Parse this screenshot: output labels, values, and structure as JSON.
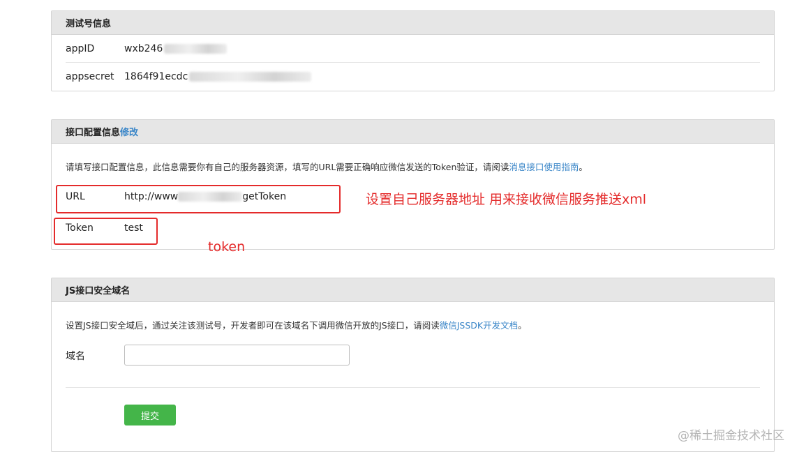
{
  "test_account": {
    "title": "测试号信息",
    "appid_label": "appID",
    "appid_value": "wxb246",
    "appsecret_label": "appsecret",
    "appsecret_value": "1864f91ecdc"
  },
  "interface_config": {
    "title": "接口配置信息",
    "edit_link": "修改",
    "description": "请填写接口配置信息，此信息需要你有自己的服务器资源，填写的URL需要正确响应微信发送的Token验证，请阅读",
    "guide_link": "消息接口使用指南",
    "description_end": "。",
    "url_label": "URL",
    "url_value_start": "http://www",
    "url_value_end": "getToken",
    "token_label": "Token",
    "token_value": "test"
  },
  "annotations": {
    "url_note": "设置自己服务器地址 用来接收微信服务推送xml",
    "token_note": "token"
  },
  "js_domain": {
    "title": "JS接口安全域名",
    "description": "设置JS接口安全域后，通过关注该测试号，开发者即可在该域名下调用微信开放的JS接口，请阅读",
    "doc_link": "微信JSSDK开发文档",
    "description_end": "。",
    "domain_label": "域名",
    "domain_value": "",
    "submit_label": "提交"
  },
  "watermark": "@稀土掘金技术社区",
  "colors": {
    "link": "#3a86c8",
    "annotation_red": "#e42b2b",
    "submit_green": "#44b549",
    "header_gray": "#e6e6e6"
  }
}
